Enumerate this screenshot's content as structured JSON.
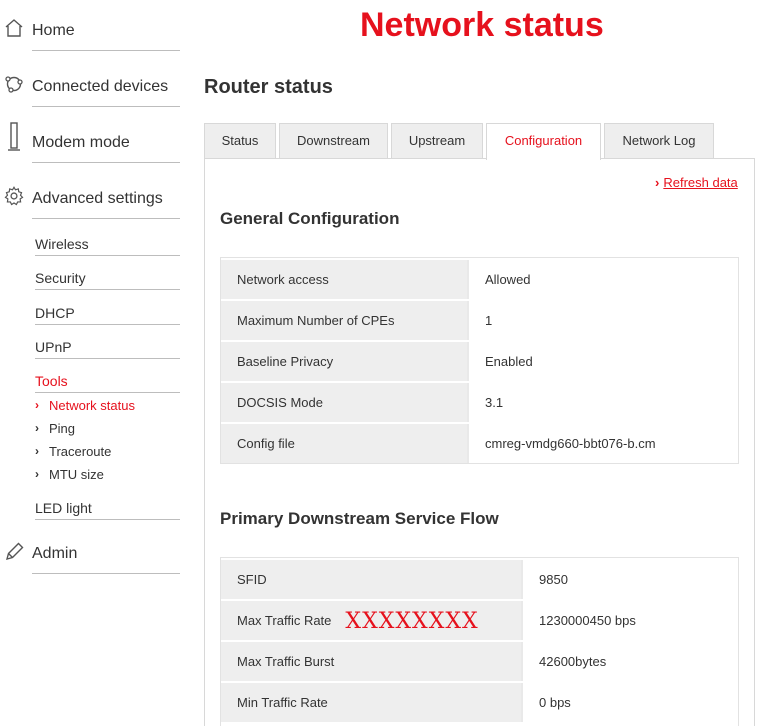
{
  "sidebar": {
    "home": "Home",
    "connected_devices": "Connected devices",
    "modem_mode": "Modem mode",
    "advanced_settings": "Advanced settings",
    "sub": {
      "wireless": "Wireless",
      "security": "Security",
      "dhcp": "DHCP",
      "upnp": "UPnP",
      "tools": "Tools",
      "led_light": "LED light"
    },
    "tools_items": {
      "network_status": "Network status",
      "ping": "Ping",
      "traceroute": "Traceroute",
      "mtu_size": "MTU size"
    },
    "admin": "Admin"
  },
  "header": {
    "title": "Network status"
  },
  "main": {
    "section_title": "Router status",
    "tabs": {
      "status": "Status",
      "downstream": "Downstream",
      "upstream": "Upstream",
      "configuration": "Configuration",
      "network_log": "Network Log"
    },
    "refresh": "Refresh data",
    "general": {
      "title": "General Configuration",
      "rows": [
        {
          "key": "Network access",
          "value": "Allowed"
        },
        {
          "key": "Maximum Number of CPEs",
          "value": "1"
        },
        {
          "key": "Baseline Privacy",
          "value": "Enabled"
        },
        {
          "key": "DOCSIS Mode",
          "value": "3.1"
        },
        {
          "key": "Config file",
          "value": "cmreg-vmdg660-bbt076-b.cm"
        }
      ]
    },
    "downstream_flow": {
      "title": "Primary Downstream Service Flow",
      "rows": [
        {
          "key": "SFID",
          "value": "9850"
        },
        {
          "key": "Max Traffic Rate",
          "value": "1230000450 bps",
          "redaction": "XXXXXXXX"
        },
        {
          "key": "Max Traffic Burst",
          "value": "42600bytes"
        },
        {
          "key": "Min Traffic Rate",
          "value": "0 bps"
        }
      ]
    }
  },
  "colors": {
    "accent": "#e6111d",
    "label_bg": "#eeeeee",
    "text": "#333333"
  }
}
